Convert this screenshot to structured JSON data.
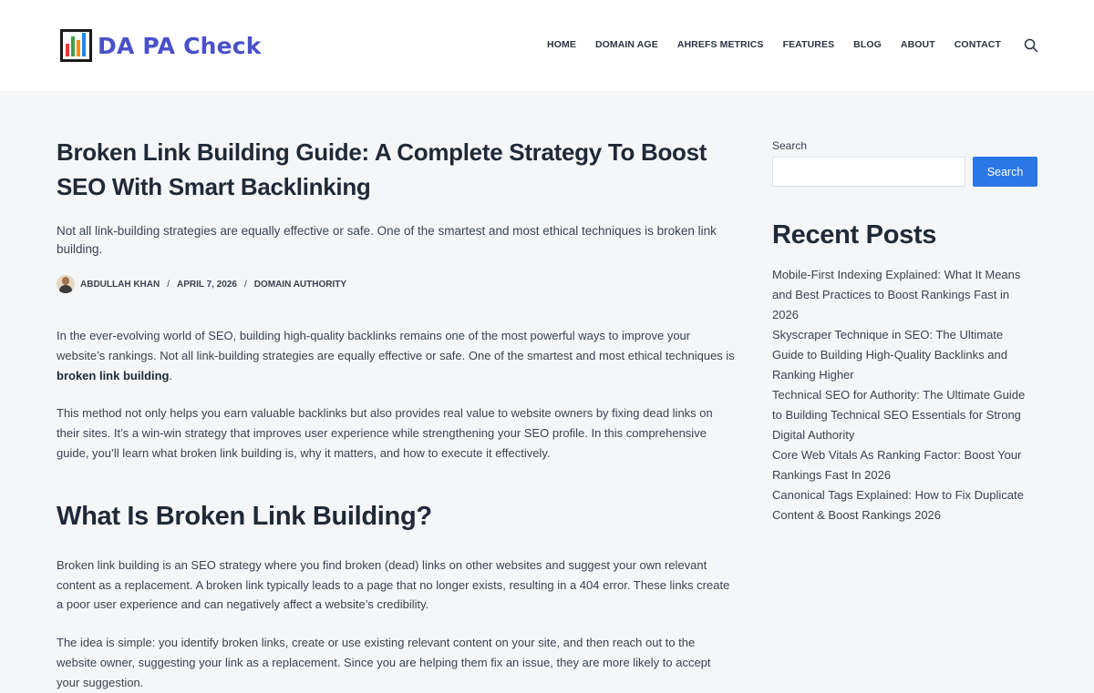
{
  "header": {
    "logo_text": "DA PA Check",
    "nav": [
      "HOME",
      "DOMAIN AGE",
      "AHREFS METRICS",
      "FEATURES",
      "BLOG",
      "ABOUT",
      "CONTACT"
    ]
  },
  "article": {
    "title": "Broken Link Building Guide: A Complete Strategy To Boost SEO With Smart Backlinking",
    "excerpt": "Not all link-building strategies are equally effective or safe. One of the smartest and most ethical techniques is broken link building.",
    "author": "ABDULLAH KHAN",
    "date": "APRIL 7, 2026",
    "category": "DOMAIN AUTHORITY",
    "meta_sep": "/",
    "p1_text": "In the ever-evolving world of SEO, building high-quality backlinks remains one of the most powerful ways to improve your website’s rankings. Not all link-building strategies are equally effective or safe. One of the smartest and most ethical techniques is ",
    "p1_bold": "broken link building",
    "p1_end": ".",
    "p2": "This method not only helps you earn valuable backlinks but also provides real value to website owners by fixing dead links on their sites. It’s a win-win strategy that improves user experience while strengthening your SEO profile. In this comprehensive guide, you’ll learn what broken link building is, why it matters, and how to execute it effectively.",
    "h2": "What Is Broken Link Building?",
    "p3": "Broken link building is an SEO strategy where you find broken (dead) links on other websites and suggest your own relevant content as a replacement. A broken link typically leads to a page that no longer exists, resulting in a 404 error. These links create a poor user experience and can negatively affect a website’s credibility.",
    "p4": "The idea is simple: you identify broken links, create or use existing relevant content on your site, and then reach out to the website owner, suggesting your link as a replacement. Since you are helping them fix an issue, they are more likely to accept your suggestion."
  },
  "sidebar": {
    "search_label": "Search",
    "search_placeholder": "",
    "search_button": "Search",
    "recent_title": "Recent Posts",
    "recent_posts": [
      "Mobile-First Indexing Explained: What It Means and Best Practices to Boost Rankings Fast in 2026",
      "Skyscraper Technique in SEO: The Ultimate Guide to Building High-Quality Backlinks and Ranking Higher",
      "Technical SEO for Authority: The Ultimate Guide to Building Technical SEO Essentials for Strong Digital Authority",
      "Core Web Vitals As Ranking Factor: Boost Your Rankings Fast In 2026",
      "Canonical Tags Explained: How to Fix Duplicate Content & Boost Rankings 2026"
    ]
  },
  "colors": {
    "logo": "#4a50c8",
    "accent": "#2b77e7",
    "heading": "#1f2937",
    "body_text": "#3a4351",
    "page_bg": "#f4f6f8"
  }
}
